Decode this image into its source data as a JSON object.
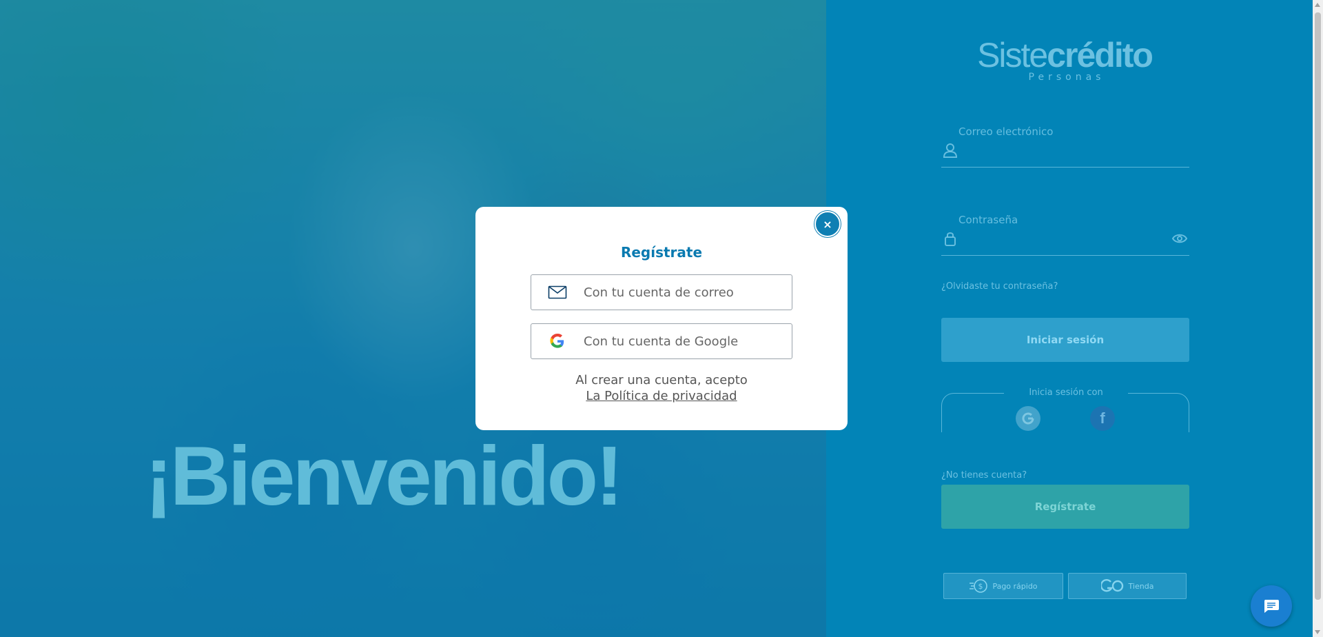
{
  "hero": {
    "welcome_text": "¡Bienvenido!"
  },
  "brand": {
    "logo_left": "Siste",
    "logo_right": "crédito",
    "logo_sub": "Personas"
  },
  "login": {
    "email_label": "Correo electrónico",
    "password_label": "Contraseña",
    "forgot_link": "¿Olvidaste tu contraseña?",
    "login_button": "Iniciar sesión",
    "social_label": "Inicia sesión con",
    "no_account_text": "¿No tienes cuenta?",
    "register_button": "Regístrate",
    "quick_pay": "Pago rápido",
    "store": "Tienda"
  },
  "modal": {
    "close_label": "×",
    "title": "Regístrate",
    "email_option": "Con tu cuenta de correo",
    "google_option": "Con tu cuenta de Google",
    "legal_text": "Al crear una cuenta, acepto",
    "privacy_link": "La Política de privacidad"
  },
  "icons": {
    "email": "envelope-icon",
    "google": "google-icon",
    "close": "close-icon",
    "user": "user-icon",
    "lock": "lock-icon",
    "eye": "eye-icon",
    "facebook": "facebook-icon",
    "chat": "chat-icon"
  },
  "colors": {
    "primary": "#0284b7",
    "modal_title": "#0a7ab0",
    "close_button": "#0f7fb3",
    "chat_button": "#1a7fd1"
  }
}
